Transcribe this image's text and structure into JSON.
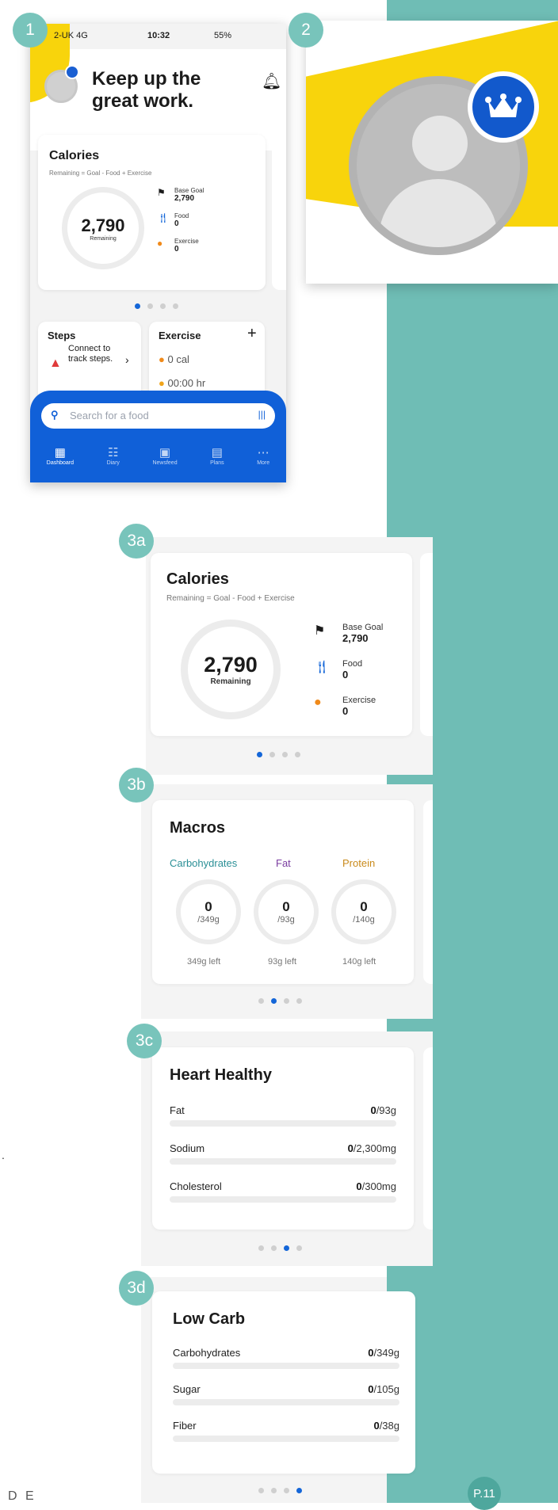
{
  "badges": {
    "b1": "1",
    "b2": "2",
    "b3a": "3a",
    "b3b": "3b",
    "b3c": "3c",
    "b3d": "3d"
  },
  "phone": {
    "status": {
      "carrier": "2-UK 4G",
      "time": "10:32",
      "battery": "55%"
    },
    "greeting": "Keep up the great work.",
    "calories": {
      "title": "Calories",
      "subtitle": "Remaining = Goal - Food + Exercise",
      "remaining_value": "2,790",
      "remaining_label": "Remaining",
      "base_goal_label": "Base Goal",
      "base_goal_value": "2,790",
      "food_label": "Food",
      "food_value": "0",
      "exercise_label": "Exercise",
      "exercise_value": "0"
    },
    "steps": {
      "title": "Steps",
      "text": "Connect to track steps."
    },
    "exercise": {
      "title": "Exercise",
      "plus": "+",
      "cal": "0 cal",
      "time": "00:00 hr"
    },
    "search_placeholder": "Search for a food",
    "tabs": [
      "Dashboard",
      "Diary",
      "Newsfeed",
      "Plans",
      "More"
    ]
  },
  "card3a": {
    "title": "Calories",
    "subtitle": "Remaining = Goal - Food + Exercise",
    "remaining_value": "2,790",
    "remaining_label": "Remaining",
    "base_goal_label": "Base Goal",
    "base_goal_value": "2,790",
    "food_label": "Food",
    "food_value": "0",
    "exercise_label": "Exercise",
    "exercise_value": "0"
  },
  "card3b": {
    "title": "Macros",
    "macros": [
      {
        "name": "Carbohydrates",
        "color": "#2a8f96",
        "value": "0",
        "total": "/349g",
        "left": "349g left"
      },
      {
        "name": "Fat",
        "color": "#7a3ca0",
        "value": "0",
        "total": "/93g",
        "left": "93g left"
      },
      {
        "name": "Protein",
        "color": "#c98a1b",
        "value": "0",
        "total": "/140g",
        "left": "140g left"
      }
    ]
  },
  "card3c": {
    "title": "Heart Healthy",
    "rows": [
      {
        "label": "Fat",
        "value": "0",
        "total": "/93g"
      },
      {
        "label": "Sodium",
        "value": "0",
        "total": "/2,300mg"
      },
      {
        "label": "Cholesterol",
        "value": "0",
        "total": "/300mg"
      }
    ]
  },
  "card3d": {
    "title": "Low Carb",
    "rows": [
      {
        "label": "Carbohydrates",
        "value": "0",
        "total": "/349g"
      },
      {
        "label": "Sugar",
        "value": "0",
        "total": "/105g"
      },
      {
        "label": "Fiber",
        "value": "0",
        "total": "/38g"
      }
    ]
  },
  "stray_mark": ".",
  "footer_left": "D E",
  "page_number": "P.11",
  "colors": {
    "teal": "#6fbdb5",
    "blue": "#1060d8",
    "yellow": "#f8d40c"
  }
}
